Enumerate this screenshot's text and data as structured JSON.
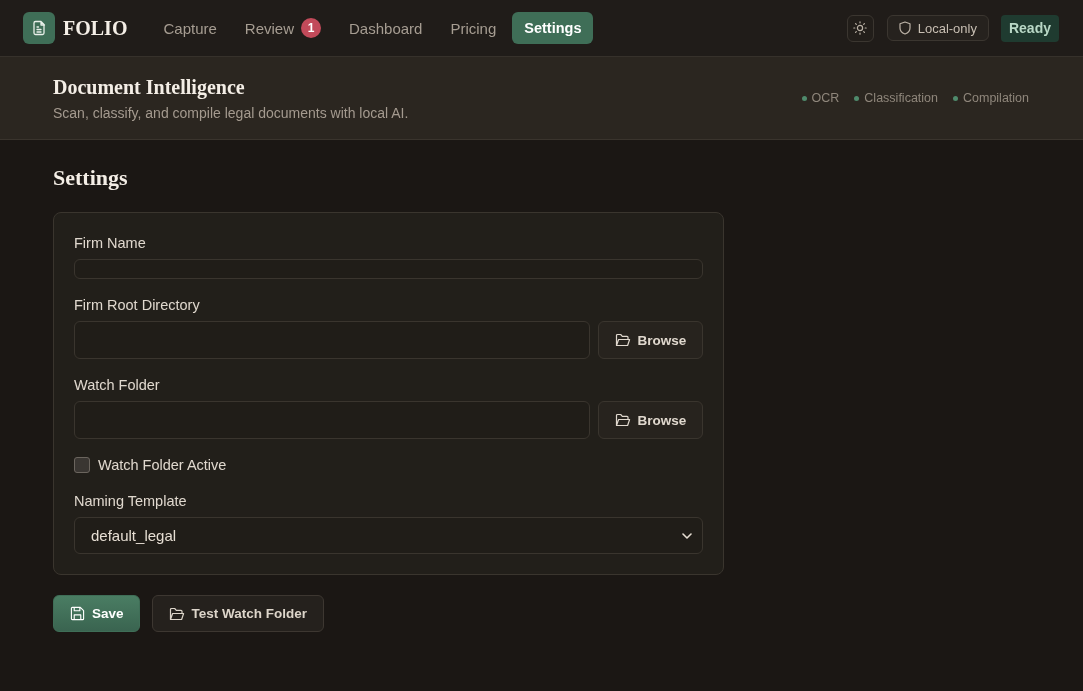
{
  "nav": {
    "brand": "FOLIO",
    "tabs": [
      {
        "label": "Capture",
        "selected": false
      },
      {
        "label": "Review",
        "badge": "1",
        "selected": false
      },
      {
        "label": "Dashboard",
        "selected": false
      },
      {
        "label": "Pricing",
        "selected": false
      },
      {
        "label": "Settings",
        "selected": true
      }
    ],
    "mode": "Local-only",
    "status": "Ready"
  },
  "hero": {
    "title": "Document Intelligence",
    "subtitle": "Scan, classify, and compile legal documents with local AI.",
    "features": [
      "OCR",
      "Classification",
      "Compilation"
    ]
  },
  "page_title": "Settings",
  "form": {
    "fields": [
      {
        "kind": "text",
        "label": "Firm Name"
      },
      {
        "kind": "path",
        "label": "Firm Root Directory",
        "button": "Browse"
      },
      {
        "kind": "path",
        "label": "Watch Folder",
        "button": "Browse"
      },
      {
        "kind": "checkbox",
        "label": "Watch Folder Active",
        "checked": false
      },
      {
        "kind": "select",
        "label": "Naming Template",
        "value": "default_legal"
      }
    ]
  },
  "actions": [
    {
      "kind": "save",
      "label": "Save"
    },
    {
      "kind": "test",
      "label": "Test Watch Folder"
    }
  ]
}
